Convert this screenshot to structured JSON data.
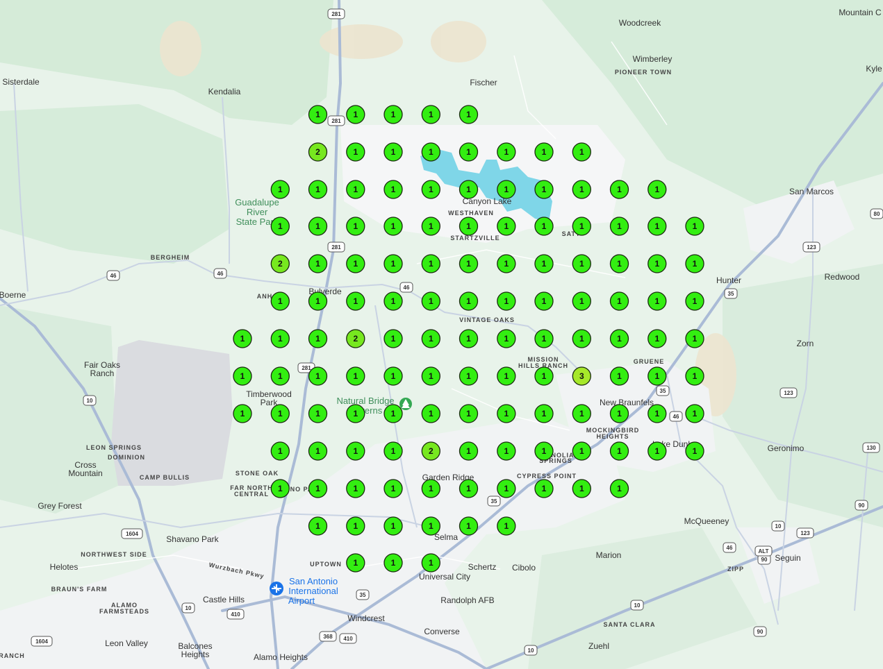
{
  "map": {
    "colors": {
      "land": "#e8f3ea",
      "greenery": "#cfe8d3",
      "urban": "#f1f3f4",
      "water": "#7fd6e8",
      "highway": "#aabbd6",
      "road": "#ffffff",
      "restricted": "#dadce0",
      "marker_count_1": "#33ee11",
      "marker_count_2": "#77e81f",
      "marker_count_3": "#a6e82a"
    },
    "places": [
      "Woodcreek",
      "Mountain C",
      "Wimberley",
      "PIONEER TOWN",
      "Kyle",
      "Sisterdale",
      "Kendalia",
      "Fischer",
      "Canyon Lake",
      "WESTHAVEN",
      "STARTZVILLE",
      "SATT",
      "San Marcos",
      "BERGHEIM",
      "Boerne",
      "Bulverde",
      "ANH",
      "VINTAGE OAKS",
      "Hunter",
      "Redwood",
      "MISSION",
      "HILLS RANCH",
      "GRUENE",
      "Zorn",
      "Fair Oaks",
      "Ranch",
      "Timberwood",
      "Park",
      "New Braunfels",
      "MOCKINGBIRD",
      "HEIGHTS",
      "Lake Dunl",
      "LEON SPRINGS",
      "DOMINION",
      "Cross",
      "Mountain",
      "Geronimo",
      "STONE OAK",
      "FAR NORTH",
      "CENTRAL",
      "CAMP BULLIS",
      "Garden Ridge",
      "CYPRESS POINT",
      "NOLIA",
      "SPRINGS",
      "Grey Forest",
      "Shavano Park",
      "McQueeney",
      "NORTHWEST SIDE",
      "Selma",
      "Marion",
      "Helotes",
      "UPTOWN",
      "Schertz",
      "Cibolo",
      "Seguin",
      "ZIPP",
      "Universal City",
      "BRAUN'S FARM",
      "ALAMO",
      "FARMSTEADS",
      "Castle Hills",
      "Randolph AFB",
      "Windcrest",
      "Converse",
      "SANTA CLARA",
      "Leon Valley",
      "Balcones",
      "Heights",
      "Zuehl",
      "Alamo Heights",
      "RANCH",
      "Wurzbach Pkwy",
      "NO PA"
    ],
    "parks": [
      "Guadalupe",
      "River",
      "State Park",
      "Natural Bridge",
      "Caverns"
    ],
    "airport": [
      "San Antonio",
      "International",
      "Airport"
    ],
    "shields": [
      "281",
      "281",
      "281",
      "281",
      "46",
      "46",
      "46",
      "46",
      "46",
      "35",
      "35",
      "35",
      "35",
      "123",
      "123",
      "123",
      "80",
      "10",
      "10",
      "10",
      "10",
      "10",
      "1604",
      "1604",
      "410",
      "410",
      "368",
      "130",
      "90",
      "90",
      "90",
      "ALT"
    ],
    "grid_markers": [
      [
        1,
        1,
        1,
        1,
        1
      ],
      [
        2,
        1,
        1,
        1,
        1,
        1,
        1,
        1
      ],
      [
        1,
        1,
        1,
        1,
        1,
        1,
        1,
        1,
        1,
        1,
        1
      ],
      [
        1,
        1,
        1,
        1,
        1,
        1,
        1,
        1,
        1,
        1,
        1,
        1
      ],
      [
        2,
        1,
        1,
        1,
        1,
        1,
        1,
        1,
        1,
        1,
        1,
        1
      ],
      [
        1,
        1,
        1,
        1,
        1,
        1,
        1,
        1,
        1,
        1,
        1,
        1
      ],
      [
        1,
        1,
        1,
        2,
        1,
        1,
        1,
        1,
        1,
        1,
        1,
        1,
        1
      ],
      [
        1,
        1,
        1,
        1,
        1,
        1,
        1,
        1,
        1,
        3,
        1,
        1,
        1
      ],
      [
        1,
        1,
        1,
        1,
        1,
        1,
        1,
        1,
        1,
        1,
        1,
        1,
        1
      ],
      [
        1,
        1,
        1,
        1,
        2,
        1,
        1,
        1,
        1,
        1,
        1,
        1
      ],
      [
        1,
        1,
        1,
        1,
        1,
        1,
        1,
        1,
        1,
        1
      ],
      [
        1,
        1,
        1,
        1,
        1,
        1
      ],
      [
        1,
        1,
        1
      ]
    ]
  }
}
